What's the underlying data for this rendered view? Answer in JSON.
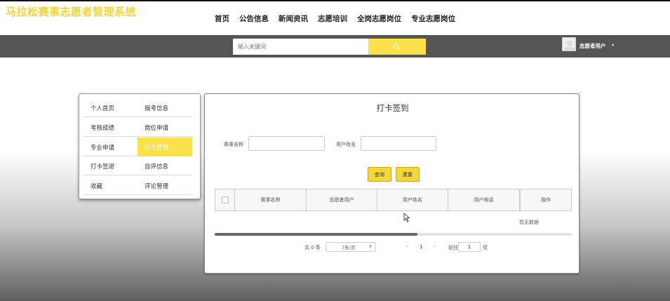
{
  "nav": [
    "首页",
    "公告信息",
    "新闻资讯",
    "志愿培训",
    "全岗志愿岗位",
    "专业志愿岗位"
  ],
  "header": {
    "title": "马拉松赛事志愿者管理系统",
    "search_placeholder": "输入关键词",
    "user_name": "志愿者用户",
    "caret": "▾"
  },
  "sidebar": [
    {
      "label": "个人首页",
      "active": false
    },
    {
      "label": "报考信息",
      "active": false
    },
    {
      "label": "考核成绩",
      "active": false
    },
    {
      "label": "岗位申请",
      "active": false
    },
    {
      "label": "专业申请",
      "active": false
    },
    {
      "label": "打卡签到",
      "active": true
    },
    {
      "label": "打卡签退",
      "active": false
    },
    {
      "label": "自评信息",
      "active": false
    },
    {
      "label": "收藏",
      "active": false
    },
    {
      "label": "评论管理",
      "active": false
    }
  ],
  "main": {
    "title": "打卡签到",
    "filters": {
      "event_label": "赛事名称",
      "user_label": "用户姓名"
    },
    "buttons": {
      "query": "查询",
      "reset": "重置"
    },
    "table": {
      "columns": [
        "赛事名称",
        "志愿者用户",
        "用户姓名",
        "用户电话",
        "操作"
      ],
      "empty_text": "暂无数据"
    },
    "pagination": {
      "total": "共 0 条",
      "page_size": "7条/页",
      "prev": "‹",
      "current": "1",
      "next": "›",
      "goto_label": "前往",
      "goto_value": "1",
      "page_unit": "页"
    }
  },
  "colors": {
    "accent": "#fce24a",
    "title": "#f5d43c",
    "header_bg": "#555555"
  }
}
